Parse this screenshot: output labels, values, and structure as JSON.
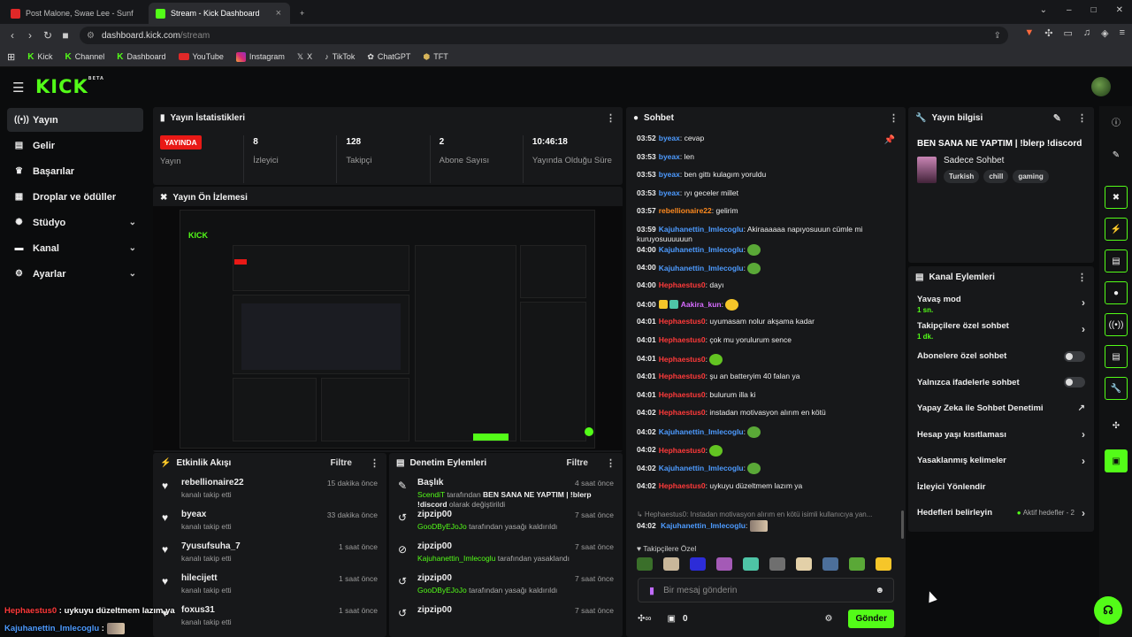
{
  "browser": {
    "tabs": [
      {
        "title": "Post Malone, Swae Lee - Sunflower (",
        "fav_color": "#e02828"
      },
      {
        "title": "Stream - Kick Dashboard",
        "fav_color": "#53fc18"
      }
    ],
    "new_tab": "+",
    "url_host": "dashboard.kick.com",
    "url_path": "/stream",
    "bookmarks": [
      "Kick",
      "Channel",
      "Dashboard",
      "YouTube",
      "Instagram",
      "X",
      "TikTok",
      "ChatGPT",
      "TFT"
    ]
  },
  "app": {
    "logo": "KICK",
    "logo_badge": "BETA",
    "accent": "#53fc18"
  },
  "sidebar": {
    "items": [
      {
        "label": "Yayın",
        "icon": "broadcast-icon",
        "glyph": "((•))",
        "active": true,
        "chevron": false
      },
      {
        "label": "Gelir",
        "icon": "revenue-icon",
        "glyph": "▤",
        "active": false,
        "chevron": false
      },
      {
        "label": "Başarılar",
        "icon": "trophy-icon",
        "glyph": "♛",
        "active": false,
        "chevron": false
      },
      {
        "label": "Droplar ve ödüller",
        "icon": "gift-icon",
        "glyph": "▦",
        "active": false,
        "chevron": false
      },
      {
        "label": "Stüdyo",
        "icon": "studio-icon",
        "glyph": "✺",
        "active": false,
        "chevron": true
      },
      {
        "label": "Kanal",
        "icon": "channel-icon",
        "glyph": "▬",
        "active": false,
        "chevron": true
      },
      {
        "label": "Ayarlar",
        "icon": "settings-icon",
        "glyph": "⚙",
        "active": false,
        "chevron": true
      }
    ]
  },
  "stats": {
    "title": "Yayın İstatistikleri",
    "live_badge": "YAYINDA",
    "live_label": "Yayın",
    "viewers": "8",
    "viewers_label": "İzleyici",
    "followers": "128",
    "followers_label": "Takipçi",
    "subs": "2",
    "subs_label": "Abone Sayısı",
    "uptime": "10:46:18",
    "uptime_label": "Yayında Olduğu Süre"
  },
  "preview": {
    "title": "Yayın Ön İzlemesi"
  },
  "activity": {
    "title": "Etkinlik Akışı",
    "filter": "Filtre",
    "items": [
      {
        "name": "rebellionaire22",
        "sub": "kanalı takip etti",
        "time": "15 dakika önce"
      },
      {
        "name": "byeax",
        "sub": "kanalı takip etti",
        "time": "33 dakika önce"
      },
      {
        "name": "7yusufsuha_7",
        "sub": "kanalı takip etti",
        "time": "1 saat önce"
      },
      {
        "name": "hilecijett",
        "sub": "kanalı takip etti",
        "time": "1 saat önce"
      },
      {
        "name": "foxus31",
        "sub": "kanalı takip etti",
        "time": "1 saat önce"
      }
    ]
  },
  "moderation": {
    "title": "Denetim Eylemleri",
    "filter": "Filtre",
    "items": [
      {
        "name": "Başlık",
        "time": "4 saat önce",
        "actor": "ScendiT",
        "mid": " tarafından ",
        "bold": "BEN SANA NE YAPTIM | !blerp !discord",
        "tail": " olarak değiştirildi"
      },
      {
        "name": "zipzip00",
        "time": "7 saat önce",
        "actor": "GooDByEJoJo",
        "mid": " tarafından yasağı kaldırıldı",
        "bold": "",
        "tail": ""
      },
      {
        "name": "zipzip00",
        "time": "7 saat önce",
        "actor": "Kajuhanettin_Imlecoglu",
        "mid": " tarafından yasaklandı",
        "bold": "",
        "tail": ""
      },
      {
        "name": "zipzip00",
        "time": "7 saat önce",
        "actor": "GooDByEJoJo",
        "mid": " tarafından yasağı kaldırıldı",
        "bold": "",
        "tail": ""
      },
      {
        "name": "zipzip00",
        "time": "7 saat önce",
        "actor": "",
        "mid": "",
        "bold": "",
        "tail": ""
      }
    ]
  },
  "chat": {
    "title": "Sohbet",
    "messages": [
      {
        "t": "03:52",
        "u": "byeax",
        "c": "blue",
        "m": ": cevap",
        "e": ""
      },
      {
        "t": "03:53",
        "u": "byeax",
        "c": "blue",
        "m": ": len",
        "e": ""
      },
      {
        "t": "03:53",
        "u": "byeax",
        "c": "blue",
        "m": ": ben gittı kulagım yoruldu",
        "e": ""
      },
      {
        "t": "03:53",
        "u": "byeax",
        "c": "blue",
        "m": ": ıyı geceler millet",
        "e": ""
      },
      {
        "t": "03:57",
        "u": "rebellionaire22",
        "c": "orange",
        "m": ": gelirim",
        "e": ""
      },
      {
        "t": "03:59",
        "u": "Kajuhanettin_Imlecoglu",
        "c": "blue",
        "m": ": Akiraaaaaa napıyosuuun cümle mi kuruyosuuuuuun",
        "e": ""
      },
      {
        "t": "04:00",
        "u": "Kajuhanettin_Imlecoglu",
        "c": "blue",
        "m": ": ",
        "e": "frog"
      },
      {
        "t": "04:00",
        "u": "Kajuhanettin_Imlecoglu",
        "c": "blue",
        "m": ": ",
        "e": "frog"
      },
      {
        "t": "04:00",
        "u": "Hephaestus0",
        "c": "red",
        "m": ": dayı",
        "e": ""
      },
      {
        "t": "04:00",
        "u": "Aakira_kun",
        "c": "pink",
        "m": ": ",
        "e": "yellow"
      },
      {
        "t": "04:01",
        "u": "Hephaestus0",
        "c": "red",
        "m": ": uyumasam nolur akşama kadar",
        "e": ""
      },
      {
        "t": "04:01",
        "u": "Hephaestus0",
        "c": "red",
        "m": ": çok mu yorulurum sence",
        "e": ""
      },
      {
        "t": "04:01",
        "u": "Hephaestus0",
        "c": "red",
        "m": ": ",
        "e": "green"
      },
      {
        "t": "04:01",
        "u": "Hephaestus0",
        "c": "red",
        "m": ": şu an batteryim 40 falan ya",
        "e": ""
      },
      {
        "t": "04:01",
        "u": "Hephaestus0",
        "c": "red",
        "m": ": bulurum illa ki",
        "e": ""
      },
      {
        "t": "04:02",
        "u": "Hephaestus0",
        "c": "red",
        "m": ": instadan motivasyon alırım en kötü",
        "e": ""
      },
      {
        "t": "04:02",
        "u": "Kajuhanettin_Imlecoglu",
        "c": "blue",
        "m": ": ",
        "e": "frog"
      },
      {
        "t": "04:02",
        "u": "Hephaestus0",
        "c": "red",
        "m": ": ",
        "e": "green"
      },
      {
        "t": "04:02",
        "u": "Kajuhanettin_Imlecoglu",
        "c": "blue",
        "m": ": ",
        "e": "frog"
      },
      {
        "t": "04:02",
        "u": "Hephaestus0",
        "c": "red",
        "m": ": uykuyu düzeltmem lazım ya",
        "e": ""
      }
    ],
    "reply_preview": "↳ Hephaestus0: Instadan motivasyon alırım en kötü isimli kullanıcıya yan...",
    "last": {
      "t": "04:02",
      "u": "Kajuhanettin_Imlecoglu",
      "m": ": "
    },
    "emote_section": "Takipçilere Özel",
    "input_placeholder": "Bir mesaj gönderin",
    "count": "0",
    "send": "Gönder"
  },
  "info": {
    "title": "Yayın bilgisi",
    "stream_title": "BEN SANA NE YAPTIM | !blerp !discord",
    "category": "Sadece Sohbet",
    "tags": [
      "Turkish",
      "chill",
      "gaming"
    ]
  },
  "actions": {
    "title": "Kanal Eylemleri",
    "items": [
      {
        "label": "Yavaş mod",
        "sub": "1 sn.",
        "type": "arrow"
      },
      {
        "label": "Takipçilere özel sohbet",
        "sub": "1 dk.",
        "type": "arrow"
      },
      {
        "label": "Abonelere özel sohbet",
        "sub": "",
        "type": "toggle"
      },
      {
        "label": "Yalnızca ifadelerle sohbet",
        "sub": "",
        "type": "toggle"
      },
      {
        "label": "Yapay Zeka ile Sohbet Denetimi",
        "sub": "",
        "type": "external"
      },
      {
        "label": "Hesap yaşı kısıtlaması",
        "sub": "",
        "type": "arrow"
      },
      {
        "label": "Yasaklanmış kelimeler",
        "sub": "",
        "type": "arrow"
      },
      {
        "label": "İzleyici Yönlendir",
        "sub": "",
        "type": "none"
      },
      {
        "label": "Hedefleri belirleyin",
        "sub": "",
        "type": "goals"
      }
    ],
    "active_goals": "Aktif hedefler - 2"
  },
  "overlay": {
    "line1_user": "Hephaestus0",
    "line1_msg": " : uykuyu düzeltmem lazım ya",
    "line2_user": "Kajuhanettin_Imlecoglu",
    "line2_msg": " : "
  }
}
